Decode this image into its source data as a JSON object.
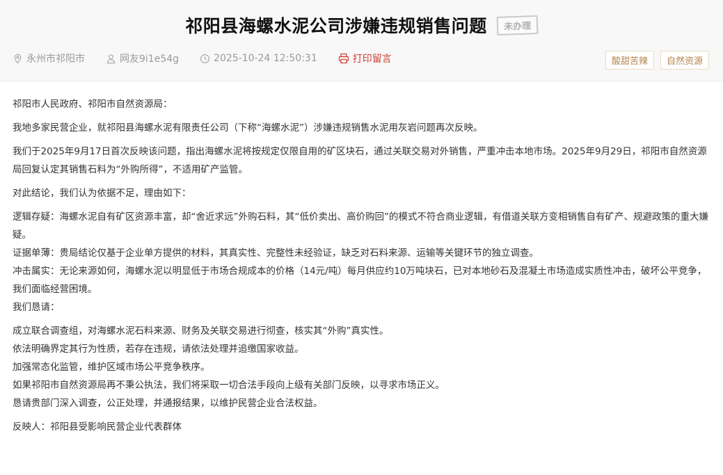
{
  "header": {
    "title": "祁阳县海螺水泥公司涉嫌违规销售问题",
    "status_stamp": "未办理",
    "location": "永州市祁阳市",
    "author": "网友9i1e54g",
    "datetime": "2025-10-24 12:50:31",
    "print_label": "打印留言",
    "tags": [
      "酸甜苦辣",
      "自然资源"
    ],
    "print_color": "#d23b2f",
    "tag_color": "#b7834b"
  },
  "body": {
    "salutation": "祁阳市人民政府、祁阳市自然资源局：",
    "p1": "我地多家民营企业，就祁阳县海螺水泥有限责任公司（下称“海螺水泥”）涉嫌违规销售水泥用灰岩问题再次反映。",
    "p2": "我们于2025年9月17日首次反映该问题，指出海螺水泥将按规定仅限自用的矿区块石，通过关联交易对外销售，严重冲击本地市场。2025年9月29日，祁阳市自然资源局回复认定其销售石料为“外购所得”，不适用矿产监管。",
    "p3": "对此结论，我们认为依据不足，理由如下：",
    "reasons": [
      "逻辑存疑：海螺水泥自有矿区资源丰富，却“舍近求远”外购石料，其“低价卖出、高价购回”的模式不符合商业逻辑，有借道关联方变相销售自有矿产、规避政策的重大嫌疑。",
      "证据单薄：贵局结论仅基于企业单方提供的材料，其真实性、完整性未经验证，缺乏对石料来源、运输等关键环节的独立调查。",
      "冲击属实：无论来源如何，海螺水泥以明显低于市场合规成本的价格（14元/吨）每月供应约10万吨块石，已对本地砂石及混凝土市场造成实质性冲击，破坏公平竞争，我们面临经营困境。",
      "我们恳请："
    ],
    "requests": [
      "成立联合调查组，对海螺水泥石料来源、财务及关联交易进行彻查，核实其“外购”真实性。",
      "依法明确界定其行为性质，若存在违规，请依法处理并追缴国家收益。",
      "加强常态化监管，维护区域市场公平竞争秩序。",
      "如果祁阳市自然资源局再不秉公执法，我们将采取一切合法手段向上级有关部门反映，以寻求市场正义。",
      "恳请贵部门深入调查，公正处理，并通报结果，以维护民营企业合法权益。"
    ],
    "signature": "反映人：祁阳县受影响民营企业代表群体"
  }
}
